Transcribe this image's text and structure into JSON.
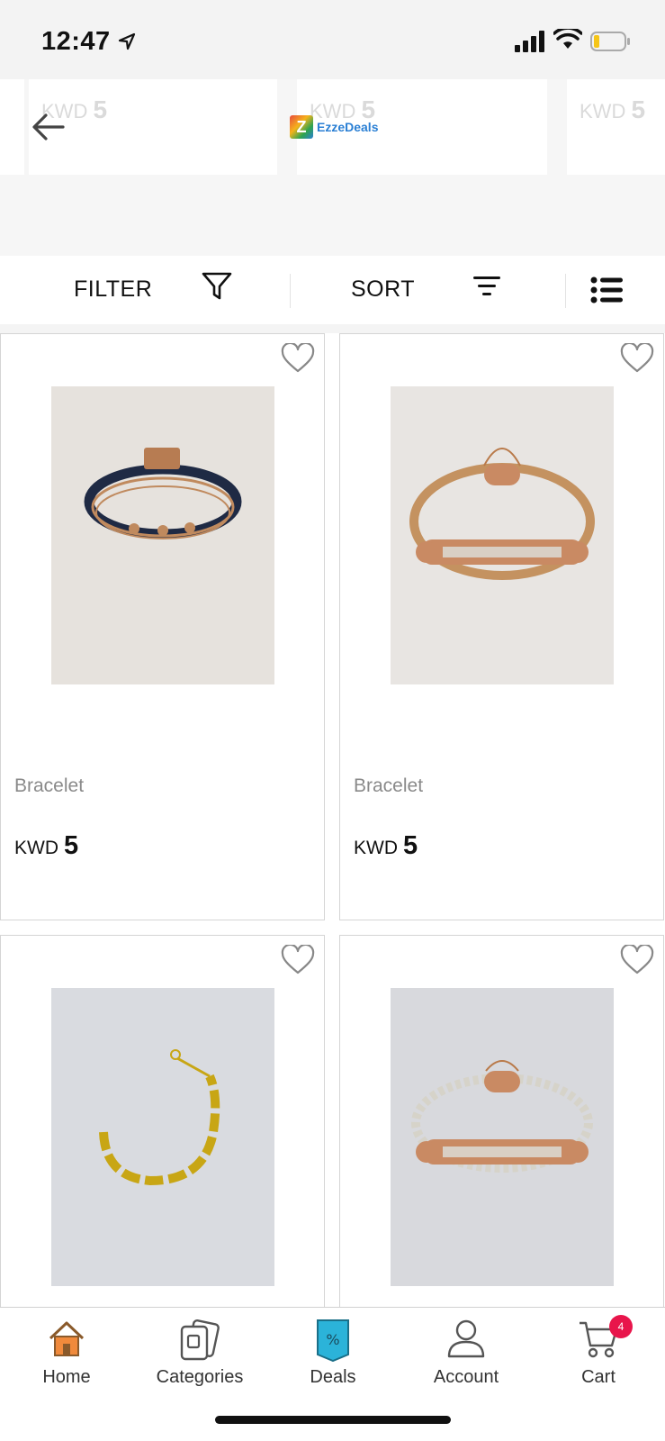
{
  "status_bar": {
    "time": "12:47"
  },
  "header": {
    "logo_text": "EzzeDeals",
    "logo_letter": "Z",
    "ghost_prices": [
      {
        "currency": "KWD",
        "amount": "5"
      },
      {
        "currency": "KWD",
        "amount": "5"
      },
      {
        "currency": "KWD",
        "amount": "5"
      }
    ]
  },
  "toolbar": {
    "filter_label": "FILTER",
    "sort_label": "SORT"
  },
  "products": [
    {
      "name": "Bracelet",
      "currency": "KWD",
      "price": "5"
    },
    {
      "name": "Bracelet",
      "currency": "KWD",
      "price": "5"
    },
    {
      "name": "",
      "currency": "",
      "price": ""
    },
    {
      "name": "",
      "currency": "",
      "price": ""
    }
  ],
  "nav": {
    "items": [
      {
        "label": "Home",
        "icon": "home-icon"
      },
      {
        "label": "Categories",
        "icon": "categories-icon"
      },
      {
        "label": "Deals",
        "icon": "deals-icon"
      },
      {
        "label": "Account",
        "icon": "account-icon"
      },
      {
        "label": "Cart",
        "icon": "cart-icon"
      }
    ],
    "cart_count": "4"
  },
  "colors": {
    "accent_home": "#f08a3c",
    "deals_blue": "#2bb3d9",
    "badge": "#e8154b"
  }
}
